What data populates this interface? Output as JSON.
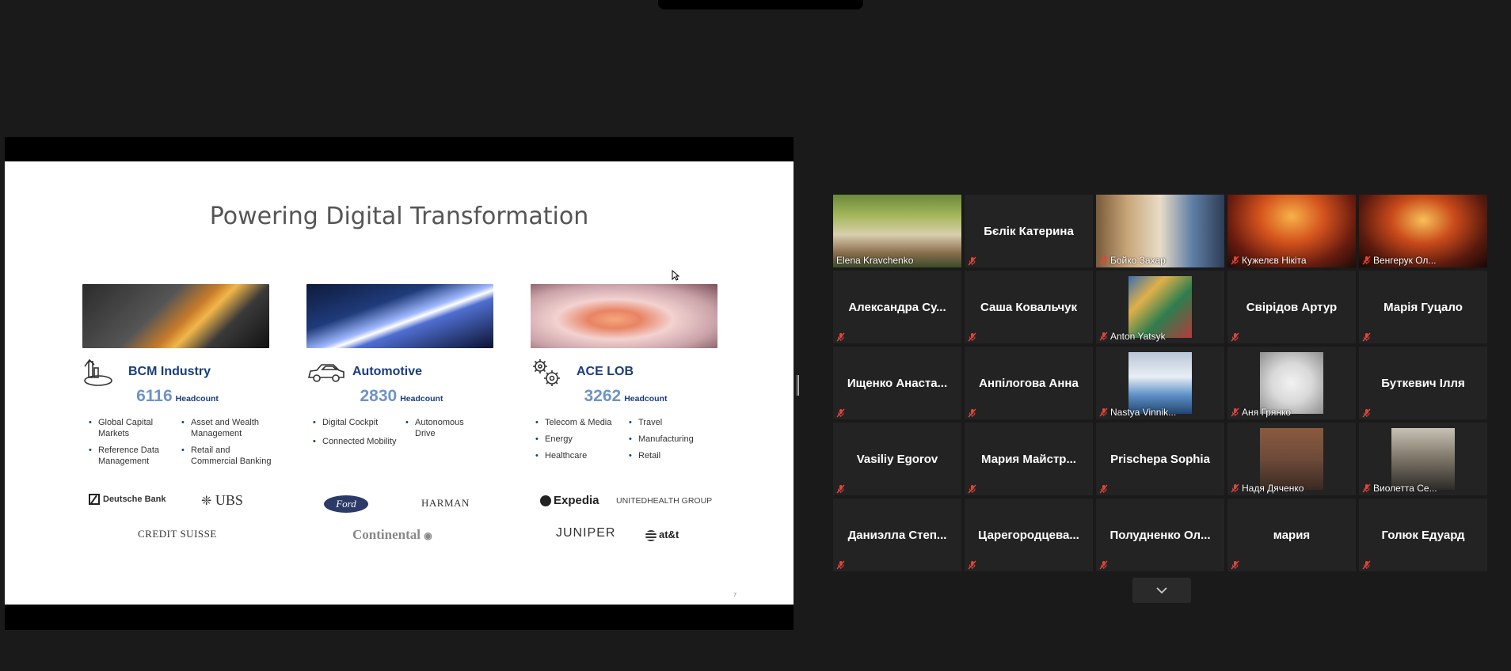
{
  "slide": {
    "title": "Powering Digital Transformation",
    "page_number": "7",
    "columns": [
      {
        "sector": "BCM Industry",
        "headcount": "6116",
        "headcount_label": "Headcount",
        "bullets_left": [
          "Global Capital Markets",
          "Reference Data Management"
        ],
        "bullets_right": [
          "Asset and Wealth Management",
          "Retail and Commercial Banking"
        ],
        "logos": [
          "Deutsche Bank",
          "UBS",
          "CREDIT SUISSE"
        ]
      },
      {
        "sector": "Automotive",
        "headcount": "2830",
        "headcount_label": "Headcount",
        "bullets_left": [
          "Digital Cockpit",
          "Connected Mobility"
        ],
        "bullets_right": [
          "Autonomous Drive"
        ],
        "logos": [
          "Ford",
          "HARMAN",
          "Continental"
        ]
      },
      {
        "sector": "ACE LOB",
        "headcount": "3262",
        "headcount_label": "Headcount",
        "bullets_left": [
          "Telecom & Media",
          "Energy",
          "Healthcare"
        ],
        "bullets_right": [
          "Travel",
          "Manufacturing",
          "Retail"
        ],
        "logos": [
          "Expedia",
          "UNITEDHEALTH GROUP",
          "JUNIPER",
          "at&t"
        ]
      }
    ]
  },
  "gallery": {
    "tiles": [
      {
        "name": "Elena Kravchenko",
        "video": true,
        "active": true,
        "muted": false
      },
      {
        "name": "Бєлік Катерина",
        "video": false,
        "muted": true
      },
      {
        "name": "Бойко Захар",
        "video": true,
        "muted": true
      },
      {
        "name": "Кужелєв Нікіта",
        "video": true,
        "muted": true
      },
      {
        "name": "Венгерук Ол...",
        "video": true,
        "muted": true
      },
      {
        "name": "Александра Су...",
        "video": false,
        "muted": true
      },
      {
        "name": "Саша Ковальчук",
        "video": false,
        "muted": true
      },
      {
        "name": "Anton Yatsyk",
        "video": true,
        "muted": true
      },
      {
        "name": "Свірідов Артур",
        "video": false,
        "muted": true
      },
      {
        "name": "Марія Гуцало",
        "video": false,
        "muted": true
      },
      {
        "name": "Ищенко Анаста...",
        "video": false,
        "muted": true
      },
      {
        "name": "Анпілогова Анна",
        "video": false,
        "muted": true
      },
      {
        "name": "Nastya Vinnik...",
        "video": true,
        "muted": true
      },
      {
        "name": "Аня Грянко",
        "video": true,
        "muted": true
      },
      {
        "name": "Буткевич Ілля",
        "video": false,
        "muted": true
      },
      {
        "name": "Vasiliy Egorov",
        "video": false,
        "muted": true
      },
      {
        "name": "Мария Майстр...",
        "video": false,
        "muted": true
      },
      {
        "name": "Prischepa Sophia",
        "video": false,
        "muted": true
      },
      {
        "name": "Надя Дяченко",
        "video": true,
        "muted": true
      },
      {
        "name": "Виолетта Се...",
        "video": true,
        "muted": true
      },
      {
        "name": "Даниэлла Степ...",
        "video": false,
        "muted": true
      },
      {
        "name": "Царегородцева...",
        "video": false,
        "muted": true
      },
      {
        "name": "Полудненко Ол...",
        "video": false,
        "muted": true
      },
      {
        "name": "мария",
        "video": false,
        "muted": true
      },
      {
        "name": "Голюк Едуард",
        "video": false,
        "muted": true
      }
    ]
  },
  "colors": {
    "active_speaker": "#e8e23d",
    "muted_icon": "#e0463c",
    "sector_text": "#1a3d7c",
    "headcount_number": "#6e93c7"
  }
}
